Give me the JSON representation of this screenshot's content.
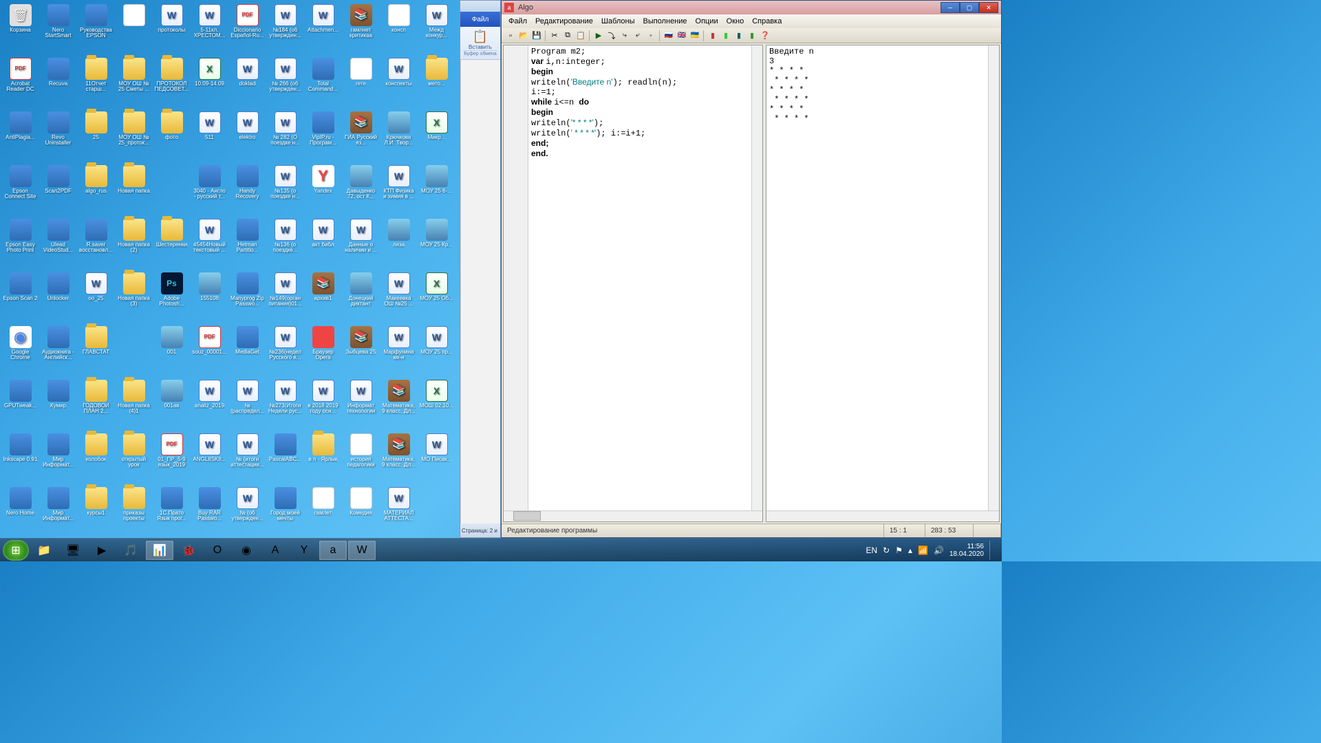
{
  "desktop_icons": [
    {
      "label": "Корзина",
      "type": "bin"
    },
    {
      "label": "Nero StartSmart",
      "type": "app"
    },
    {
      "label": "Руководства EPSON",
      "type": "app"
    },
    {
      "label": "",
      "type": "txt"
    },
    {
      "label": "протоколы",
      "type": "word"
    },
    {
      "label": "5-11кл. ХРЕСТОМ...",
      "type": "word"
    },
    {
      "label": "Diccionario Español-Ru...",
      "type": "pdf"
    },
    {
      "label": "№184 (об утвержден...",
      "type": "word"
    },
    {
      "label": "Attachmen...",
      "type": "word"
    },
    {
      "label": "гамлнет критикаа",
      "type": "rar"
    },
    {
      "label": "консп",
      "type": "txt"
    },
    {
      "label": "Межд конкур...",
      "type": "word"
    },
    {
      "label": "Acrobat Reader DC",
      "type": "pdf"
    },
    {
      "label": "Recuva",
      "type": "app"
    },
    {
      "label": "11Отчет старш...",
      "type": "folder"
    },
    {
      "label": "МОУ ОШ № 25 Сметы ...",
      "type": "folder"
    },
    {
      "label": "ПРОТОКОЛ ПЕДСОВЕТ...",
      "type": "folder"
    },
    {
      "label": "10.09-14.09",
      "type": "excel"
    },
    {
      "label": "doklad",
      "type": "word"
    },
    {
      "label": "№ 266 (об утвержден...",
      "type": "word"
    },
    {
      "label": "Total Command...",
      "type": "app"
    },
    {
      "label": "гете",
      "type": "txt"
    },
    {
      "label": "конспекты",
      "type": "word"
    },
    {
      "label": "мето...",
      "type": "folder"
    },
    {
      "label": "AntiPlagia...",
      "type": "app"
    },
    {
      "label": "Revo Uninstaller",
      "type": "app"
    },
    {
      "label": "25",
      "type": "folder"
    },
    {
      "label": "МОУ ОШ № 25_проток...",
      "type": "folder"
    },
    {
      "label": "фото",
      "type": "folder"
    },
    {
      "label": "511",
      "type": "word"
    },
    {
      "label": "elektro",
      "type": "word"
    },
    {
      "label": "№ 282 (О поездке н...",
      "type": "word"
    },
    {
      "label": "VipIP.ru - Програм...",
      "type": "app"
    },
    {
      "label": "ГИА Русский яз...",
      "type": "rar"
    },
    {
      "label": "Крючкова Л.И. Твор...",
      "type": "img"
    },
    {
      "label": "Микр...",
      "type": "excel"
    },
    {
      "label": "Epson Connect Site",
      "type": "app"
    },
    {
      "label": "Scan2PDF",
      "type": "app"
    },
    {
      "label": "algo_rus",
      "type": "folder"
    },
    {
      "label": "Новая папка",
      "type": "folder"
    },
    {
      "label": "",
      "type": "blank"
    },
    {
      "label": "3040 - Англо - русский т...",
      "type": "app"
    },
    {
      "label": "Handy Recovery",
      "type": "app"
    },
    {
      "label": "№135 (о поездке н...",
      "type": "word"
    },
    {
      "label": "Yandex",
      "type": "ya"
    },
    {
      "label": "Давыденко 72, ост К...",
      "type": "img"
    },
    {
      "label": "КТП Физика и химия в ...",
      "type": "word"
    },
    {
      "label": "МОУ 25 6-...",
      "type": "img"
    },
    {
      "label": "Epson Easy Photo Print",
      "type": "app"
    },
    {
      "label": "Ulead VideoStud...",
      "type": "app"
    },
    {
      "label": "R.saver восстановл...",
      "type": "app"
    },
    {
      "label": "Новая папка (2)",
      "type": "folder"
    },
    {
      "label": "Шестеренки",
      "type": "folder"
    },
    {
      "label": "45454Новый текстовый ...",
      "type": "word"
    },
    {
      "label": "Hetman Partitio...",
      "type": "app"
    },
    {
      "label": "№136 (о поездке...",
      "type": "word"
    },
    {
      "label": "акт библ",
      "type": "word"
    },
    {
      "label": "Данные о наличии и ...",
      "type": "word"
    },
    {
      "label": "лиза",
      "type": "img"
    },
    {
      "label": "МОУ 25 Кр...",
      "type": "img"
    },
    {
      "label": "Epson Scan 2",
      "type": "app"
    },
    {
      "label": "Unlocker",
      "type": "app"
    },
    {
      "label": "оо_25",
      "type": "word"
    },
    {
      "label": "Новая папка (3)",
      "type": "folder"
    },
    {
      "label": "Adobe Photosh...",
      "type": "ps"
    },
    {
      "label": "155108",
      "type": "img"
    },
    {
      "label": "Manyprog Zip Passwo...",
      "type": "app"
    },
    {
      "label": "№149(орган питания)01...",
      "type": "word"
    },
    {
      "label": "архив1",
      "type": "rar"
    },
    {
      "label": "Донецкий диктант",
      "type": "img"
    },
    {
      "label": "Макеевка ОШ №25 ...",
      "type": "word"
    },
    {
      "label": "МОУ 25 Об...",
      "type": "excel"
    },
    {
      "label": "Google Chrome",
      "type": "chrome"
    },
    {
      "label": "Аудиокнига - Английск...",
      "type": "app"
    },
    {
      "label": "ГЛАВСТАТ",
      "type": "folder"
    },
    {
      "label": "",
      "type": "blank"
    },
    {
      "label": "001",
      "type": "img"
    },
    {
      "label": "souz_00001...",
      "type": "pdf"
    },
    {
      "label": "MediaGet",
      "type": "app"
    },
    {
      "label": "№236(недел Русского я...",
      "type": "word"
    },
    {
      "label": "Браузер Opera",
      "type": "opera"
    },
    {
      "label": "Зыбцева 25",
      "type": "rar"
    },
    {
      "label": "Марфунина мк-н",
      "type": "word"
    },
    {
      "label": "МОУ 25 пр...",
      "type": "word"
    },
    {
      "label": "GPUTweak...",
      "type": "app"
    },
    {
      "label": "Кумир",
      "type": "app"
    },
    {
      "label": "ГОДОВОЙ ПЛАН 2...",
      "type": "folder"
    },
    {
      "label": "Новая папка (4)1",
      "type": "folder"
    },
    {
      "label": "001ав",
      "type": "img"
    },
    {
      "label": "analiz_2019",
      "type": "word"
    },
    {
      "label": "№ (распредел...",
      "type": "word"
    },
    {
      "label": "№273(Итоги Недели рус...",
      "type": "word"
    },
    {
      "label": "в 2018 2019 году осн...",
      "type": "word"
    },
    {
      "label": "Информат технологии",
      "type": "word"
    },
    {
      "label": "Математика, 9 класс, Дл...",
      "type": "rar"
    },
    {
      "label": "МОШ 02.10...",
      "type": "excel"
    },
    {
      "label": "Inkscape 0.91",
      "type": "app"
    },
    {
      "label": "Мир Информат...",
      "type": "app"
    },
    {
      "label": "колобок",
      "type": "folder"
    },
    {
      "label": "открытый урок",
      "type": "folder"
    },
    {
      "label": "01_ПР_5-9 язык_2019",
      "type": "pdf"
    },
    {
      "label": "ANGLIISKII...",
      "type": "word"
    },
    {
      "label": "№ (итоги аттестации...",
      "type": "word"
    },
    {
      "label": "PascalABC...",
      "type": "app"
    },
    {
      "label": "в п - Ярлык",
      "type": "folder"
    },
    {
      "label": "история педагогики",
      "type": "txt"
    },
    {
      "label": "Математика, 9 класс. Дл...",
      "type": "rar"
    },
    {
      "label": "МО Писак...",
      "type": "word"
    },
    {
      "label": "Nero Home",
      "type": "app"
    },
    {
      "label": "Мир Информат...",
      "type": "app"
    },
    {
      "label": "курсы1",
      "type": "folder"
    },
    {
      "label": "приказы проекты",
      "type": "folder"
    },
    {
      "label": "1С.Прато Язык прог...",
      "type": "app"
    },
    {
      "label": "Buy RAR Passwo...",
      "type": "app"
    },
    {
      "label": "№ (об утвержден...",
      "type": "word"
    },
    {
      "label": "Город моей мечты",
      "type": "app"
    },
    {
      "label": "гамлет",
      "type": "txt"
    },
    {
      "label": "Комедия",
      "type": "txt"
    },
    {
      "label": "МАТЕРИАЛ АТТЕСТА...",
      "type": "word"
    },
    {
      "label": "",
      "type": "blank"
    }
  ],
  "word_window": {
    "file_tab": "Файл",
    "paste": "Вставить",
    "clipboard": "Буфер обмена",
    "status": "Страница: 2 и"
  },
  "algo_window": {
    "title": "Algo",
    "menu": [
      "Файл",
      "Редактирование",
      "Шаблоны",
      "Выполнение",
      "Опции",
      "Окно",
      "Справка"
    ],
    "code_lines": [
      {
        "t": "Program ",
        "k": false
      },
      {
        "t": "m2;",
        "nl": true
      },
      {
        "t": "var ",
        "k": true
      },
      {
        "t": "i,n:integer;",
        "nl": true
      },
      {
        "t": "begin",
        "k": true,
        "nl": true
      },
      {
        "t": "writeln(",
        "k": false
      },
      {
        "t": "'Введите n'",
        "s": true
      },
      {
        "t": "); readln(n);",
        "nl": true
      },
      {
        "t": "i:=1;",
        "nl": true
      },
      {
        "t": "while ",
        "k": true
      },
      {
        "t": "i<=n ",
        "k": false
      },
      {
        "t": "do",
        "k": true,
        "nl": true
      },
      {
        "t": "begin",
        "k": true,
        "nl": true
      },
      {
        "t": "writeln(",
        "k": false
      },
      {
        "t": "'* * * *'",
        "s": true
      },
      {
        "t": ");",
        "nl": true
      },
      {
        "t": "writeln(",
        "k": false
      },
      {
        "t": "' * * * *'",
        "s": true
      },
      {
        "t": "); i:=i+1;",
        "nl": true
      },
      {
        "t": "end;",
        "k": true,
        "nl": true
      },
      {
        "t": "end.",
        "k": true,
        "nl": true
      }
    ],
    "output": "Введите n\n3\n* * * *\n * * * *\n* * * *\n * * * *\n* * * *\n * * * *",
    "status_left": "Редактирование программы",
    "status_pos1": "15 : 1",
    "status_pos2": "283 : 53"
  },
  "taskbar": {
    "items": [
      {
        "glyph": "📁",
        "active": false
      },
      {
        "glyph": "🖥",
        "active": false
      },
      {
        "glyph": "▶",
        "active": false
      },
      {
        "glyph": "🎵",
        "active": false
      },
      {
        "glyph": "📊",
        "active": true
      },
      {
        "glyph": "🐞",
        "active": false
      },
      {
        "glyph": "O",
        "active": false
      },
      {
        "glyph": "◉",
        "active": false
      },
      {
        "glyph": "A",
        "active": false
      },
      {
        "glyph": "Y",
        "active": false
      },
      {
        "glyph": "a",
        "active": true
      },
      {
        "glyph": "W",
        "active": true
      }
    ],
    "lang": "EN",
    "time": "11:56",
    "date": "18.04.2020"
  }
}
